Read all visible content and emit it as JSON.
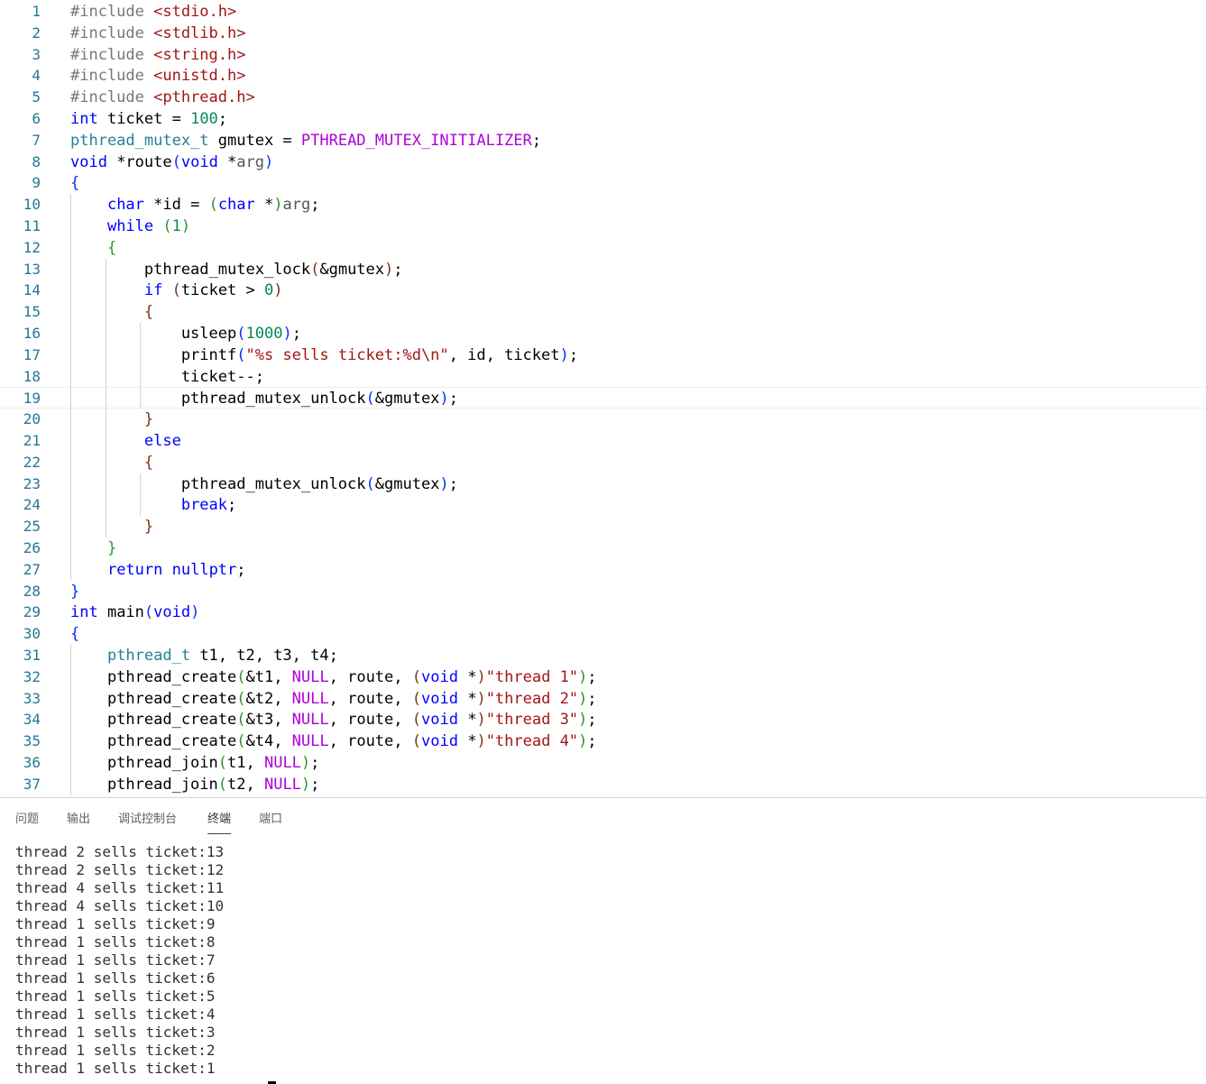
{
  "editor": {
    "current_line": 19,
    "lines": [
      {
        "n": "1",
        "tokens": [
          {
            "t": "#include ",
            "c": "pre"
          },
          {
            "t": "<stdio.h>",
            "c": "inc"
          }
        ]
      },
      {
        "n": "2",
        "tokens": [
          {
            "t": "#include ",
            "c": "pre"
          },
          {
            "t": "<stdlib.h>",
            "c": "inc"
          }
        ]
      },
      {
        "n": "3",
        "tokens": [
          {
            "t": "#include ",
            "c": "pre"
          },
          {
            "t": "<string.h>",
            "c": "inc"
          }
        ]
      },
      {
        "n": "4",
        "tokens": [
          {
            "t": "#include ",
            "c": "pre"
          },
          {
            "t": "<unistd.h>",
            "c": "inc"
          }
        ]
      },
      {
        "n": "5",
        "tokens": [
          {
            "t": "#include ",
            "c": "pre"
          },
          {
            "t": "<pthread.h>",
            "c": "inc"
          }
        ]
      },
      {
        "n": "6",
        "tokens": [
          {
            "t": "int",
            "c": "kw"
          },
          {
            "t": " ticket = "
          },
          {
            "t": "100",
            "c": "num"
          },
          {
            "t": ";"
          }
        ]
      },
      {
        "n": "7",
        "tokens": [
          {
            "t": "pthread_mutex_t",
            "c": "type"
          },
          {
            "t": " gmutex = "
          },
          {
            "t": "PTHREAD_MUTEX_INITIALIZER",
            "c": "macro"
          },
          {
            "t": ";"
          }
        ]
      },
      {
        "n": "8",
        "tokens": [
          {
            "t": "void",
            "c": "kw"
          },
          {
            "t": " *route"
          },
          {
            "t": "(",
            "c": "b1"
          },
          {
            "t": "void",
            "c": "kw"
          },
          {
            "t": " *"
          },
          {
            "t": "arg",
            "c": "param"
          },
          {
            "t": ")",
            "c": "b1"
          }
        ]
      },
      {
        "n": "9",
        "tokens": [
          {
            "t": "{",
            "c": "b1"
          }
        ]
      },
      {
        "n": "10",
        "tokens": [
          {
            "t": "    "
          },
          {
            "t": "char",
            "c": "kw"
          },
          {
            "t": " *id = "
          },
          {
            "t": "(",
            "c": "b2"
          },
          {
            "t": "char",
            "c": "kw"
          },
          {
            "t": " *"
          },
          {
            "t": ")",
            "c": "b2"
          },
          {
            "t": "arg",
            "c": "param"
          },
          {
            "t": ";"
          }
        ]
      },
      {
        "n": "11",
        "tokens": [
          {
            "t": "    "
          },
          {
            "t": "while",
            "c": "kw"
          },
          {
            "t": " "
          },
          {
            "t": "(",
            "c": "b2"
          },
          {
            "t": "1",
            "c": "num"
          },
          {
            "t": ")",
            "c": "b2"
          }
        ]
      },
      {
        "n": "12",
        "tokens": [
          {
            "t": "    "
          },
          {
            "t": "{",
            "c": "b2"
          }
        ]
      },
      {
        "n": "13",
        "tokens": [
          {
            "t": "        pthread_mutex_lock"
          },
          {
            "t": "(",
            "c": "b3"
          },
          {
            "t": "&gmutex"
          },
          {
            "t": ")",
            "c": "b3"
          },
          {
            "t": ";"
          }
        ]
      },
      {
        "n": "14",
        "tokens": [
          {
            "t": "        "
          },
          {
            "t": "if",
            "c": "kw"
          },
          {
            "t": " "
          },
          {
            "t": "(",
            "c": "b3"
          },
          {
            "t": "ticket > "
          },
          {
            "t": "0",
            "c": "num"
          },
          {
            "t": ")",
            "c": "b3"
          }
        ]
      },
      {
        "n": "15",
        "tokens": [
          {
            "t": "        "
          },
          {
            "t": "{",
            "c": "b3"
          }
        ]
      },
      {
        "n": "16",
        "tokens": [
          {
            "t": "            usleep"
          },
          {
            "t": "(",
            "c": "b1"
          },
          {
            "t": "1000",
            "c": "num"
          },
          {
            "t": ")",
            "c": "b1"
          },
          {
            "t": ";"
          }
        ]
      },
      {
        "n": "17",
        "tokens": [
          {
            "t": "            printf"
          },
          {
            "t": "(",
            "c": "b1"
          },
          {
            "t": "\"%s sells ticket:%d\\n\"",
            "c": "str"
          },
          {
            "t": ", id, ticket"
          },
          {
            "t": ")",
            "c": "b1"
          },
          {
            "t": ";"
          }
        ]
      },
      {
        "n": "18",
        "tokens": [
          {
            "t": "            ticket--;"
          }
        ]
      },
      {
        "n": "19",
        "tokens": [
          {
            "t": "            pthread_mutex_unlock"
          },
          {
            "t": "(",
            "c": "b1"
          },
          {
            "t": "&gmutex"
          },
          {
            "t": ")",
            "c": "b1"
          },
          {
            "t": ";"
          }
        ]
      },
      {
        "n": "20",
        "tokens": [
          {
            "t": "        "
          },
          {
            "t": "}",
            "c": "b3"
          }
        ]
      },
      {
        "n": "21",
        "tokens": [
          {
            "t": "        "
          },
          {
            "t": "else",
            "c": "kw"
          }
        ]
      },
      {
        "n": "22",
        "tokens": [
          {
            "t": "        "
          },
          {
            "t": "{",
            "c": "b3"
          }
        ]
      },
      {
        "n": "23",
        "tokens": [
          {
            "t": "            pthread_mutex_unlock"
          },
          {
            "t": "(",
            "c": "b1"
          },
          {
            "t": "&gmutex"
          },
          {
            "t": ")",
            "c": "b1"
          },
          {
            "t": ";"
          }
        ]
      },
      {
        "n": "24",
        "tokens": [
          {
            "t": "            "
          },
          {
            "t": "break",
            "c": "kw"
          },
          {
            "t": ";"
          }
        ]
      },
      {
        "n": "25",
        "tokens": [
          {
            "t": "        "
          },
          {
            "t": "}",
            "c": "b3"
          }
        ]
      },
      {
        "n": "26",
        "tokens": [
          {
            "t": "    "
          },
          {
            "t": "}",
            "c": "b2"
          }
        ]
      },
      {
        "n": "27",
        "tokens": [
          {
            "t": "    "
          },
          {
            "t": "return",
            "c": "kw"
          },
          {
            "t": " "
          },
          {
            "t": "nullptr",
            "c": "kw"
          },
          {
            "t": ";"
          }
        ]
      },
      {
        "n": "28",
        "tokens": [
          {
            "t": "}",
            "c": "b1"
          }
        ]
      },
      {
        "n": "29",
        "tokens": [
          {
            "t": "int",
            "c": "kw"
          },
          {
            "t": " main"
          },
          {
            "t": "(",
            "c": "b1"
          },
          {
            "t": "void",
            "c": "kw"
          },
          {
            "t": ")",
            "c": "b1"
          }
        ]
      },
      {
        "n": "30",
        "tokens": [
          {
            "t": "{",
            "c": "b1"
          }
        ]
      },
      {
        "n": "31",
        "tokens": [
          {
            "t": "    "
          },
          {
            "t": "pthread_t",
            "c": "type"
          },
          {
            "t": " t1, t2, t3, t4;"
          }
        ]
      },
      {
        "n": "32",
        "tokens": [
          {
            "t": "    pthread_create"
          },
          {
            "t": "(",
            "c": "b2"
          },
          {
            "t": "&t1, "
          },
          {
            "t": "NULL",
            "c": "macro"
          },
          {
            "t": ", route, "
          },
          {
            "t": "(",
            "c": "b3"
          },
          {
            "t": "void",
            "c": "kw"
          },
          {
            "t": " *"
          },
          {
            "t": ")",
            "c": "b3"
          },
          {
            "t": "\"thread 1\"",
            "c": "str"
          },
          {
            "t": ")",
            "c": "b2"
          },
          {
            "t": ";"
          }
        ]
      },
      {
        "n": "33",
        "tokens": [
          {
            "t": "    pthread_create"
          },
          {
            "t": "(",
            "c": "b2"
          },
          {
            "t": "&t2, "
          },
          {
            "t": "NULL",
            "c": "macro"
          },
          {
            "t": ", route, "
          },
          {
            "t": "(",
            "c": "b3"
          },
          {
            "t": "void",
            "c": "kw"
          },
          {
            "t": " *"
          },
          {
            "t": ")",
            "c": "b3"
          },
          {
            "t": "\"thread 2\"",
            "c": "str"
          },
          {
            "t": ")",
            "c": "b2"
          },
          {
            "t": ";"
          }
        ]
      },
      {
        "n": "34",
        "tokens": [
          {
            "t": "    pthread_create"
          },
          {
            "t": "(",
            "c": "b2"
          },
          {
            "t": "&t3, "
          },
          {
            "t": "NULL",
            "c": "macro"
          },
          {
            "t": ", route, "
          },
          {
            "t": "(",
            "c": "b3"
          },
          {
            "t": "void",
            "c": "kw"
          },
          {
            "t": " *"
          },
          {
            "t": ")",
            "c": "b3"
          },
          {
            "t": "\"thread 3\"",
            "c": "str"
          },
          {
            "t": ")",
            "c": "b2"
          },
          {
            "t": ";"
          }
        ]
      },
      {
        "n": "35",
        "tokens": [
          {
            "t": "    pthread_create"
          },
          {
            "t": "(",
            "c": "b2"
          },
          {
            "t": "&t4, "
          },
          {
            "t": "NULL",
            "c": "macro"
          },
          {
            "t": ", route, "
          },
          {
            "t": "(",
            "c": "b3"
          },
          {
            "t": "void",
            "c": "kw"
          },
          {
            "t": " *"
          },
          {
            "t": ")",
            "c": "b3"
          },
          {
            "t": "\"thread 4\"",
            "c": "str"
          },
          {
            "t": ")",
            "c": "b2"
          },
          {
            "t": ";"
          }
        ]
      },
      {
        "n": "36",
        "tokens": [
          {
            "t": "    pthread_join"
          },
          {
            "t": "(",
            "c": "b2"
          },
          {
            "t": "t1, "
          },
          {
            "t": "NULL",
            "c": "macro"
          },
          {
            "t": ")",
            "c": "b2"
          },
          {
            "t": ";"
          }
        ]
      },
      {
        "n": "37",
        "tokens": [
          {
            "t": "    pthread_join"
          },
          {
            "t": "(",
            "c": "b2"
          },
          {
            "t": "t2, "
          },
          {
            "t": "NULL",
            "c": "macro"
          },
          {
            "t": ")",
            "c": "b2"
          },
          {
            "t": ";"
          }
        ]
      }
    ]
  },
  "panel": {
    "tabs": [
      {
        "label": "问题",
        "active": false
      },
      {
        "label": "输出",
        "active": false
      },
      {
        "label": "调试控制台",
        "active": false
      },
      {
        "label": "终端",
        "active": true
      },
      {
        "label": "端口",
        "active": false
      }
    ],
    "terminal_lines": [
      "thread 2 sells ticket:13",
      "thread 2 sells ticket:12",
      "thread 4 sells ticket:11",
      "thread 4 sells ticket:10",
      "thread 1 sells ticket:9",
      "thread 1 sells ticket:8",
      "thread 1 sells ticket:7",
      "thread 1 sells ticket:6",
      "thread 1 sells ticket:5",
      "thread 1 sells ticket:4",
      "thread 1 sells ticket:3",
      "thread 1 sells ticket:2",
      "thread 1 sells ticket:1"
    ]
  },
  "colors": {
    "line_number": "#237893",
    "keyword": "#0000ff",
    "type": "#267f99",
    "number": "#098658",
    "string": "#a31515",
    "macro": "#af00db"
  }
}
